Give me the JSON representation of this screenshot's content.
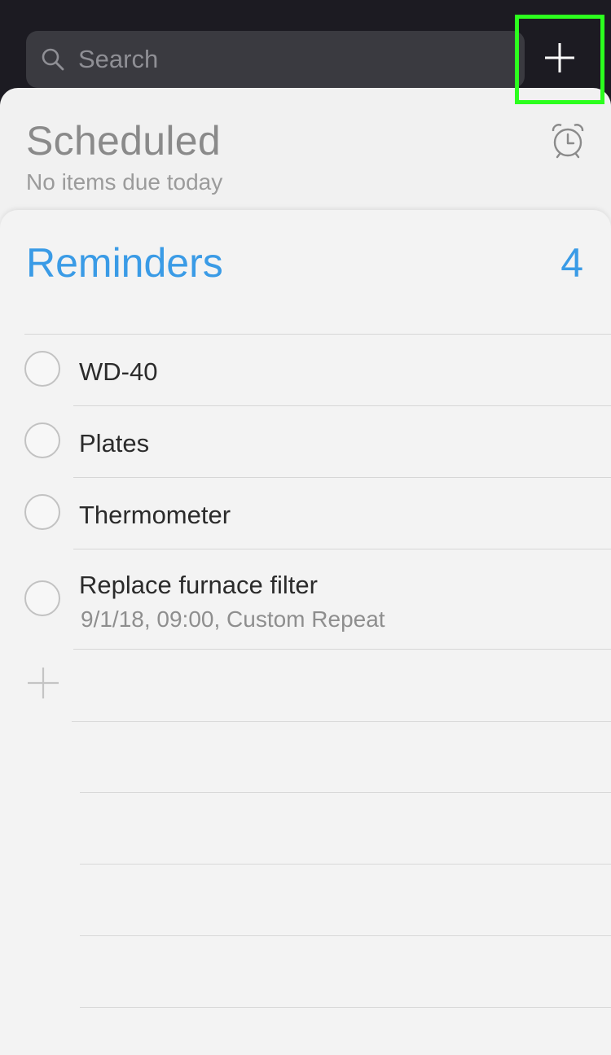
{
  "search": {
    "placeholder": "Search"
  },
  "toolbar": {
    "add_icon": "plus-icon"
  },
  "scheduled": {
    "title": "Scheduled",
    "subtitle": "No items due today",
    "icon": "alarm-clock-icon"
  },
  "reminders": {
    "title": "Reminders",
    "count": "4",
    "items": [
      {
        "title": "WD-40"
      },
      {
        "title": "Plates"
      },
      {
        "title": "Thermometer"
      },
      {
        "title": "Replace furnace filter",
        "meta": "9/1/18, 09:00, Custom Repeat"
      }
    ]
  },
  "colors": {
    "accent": "#3a9be6",
    "highlight": "#2cff1e"
  }
}
